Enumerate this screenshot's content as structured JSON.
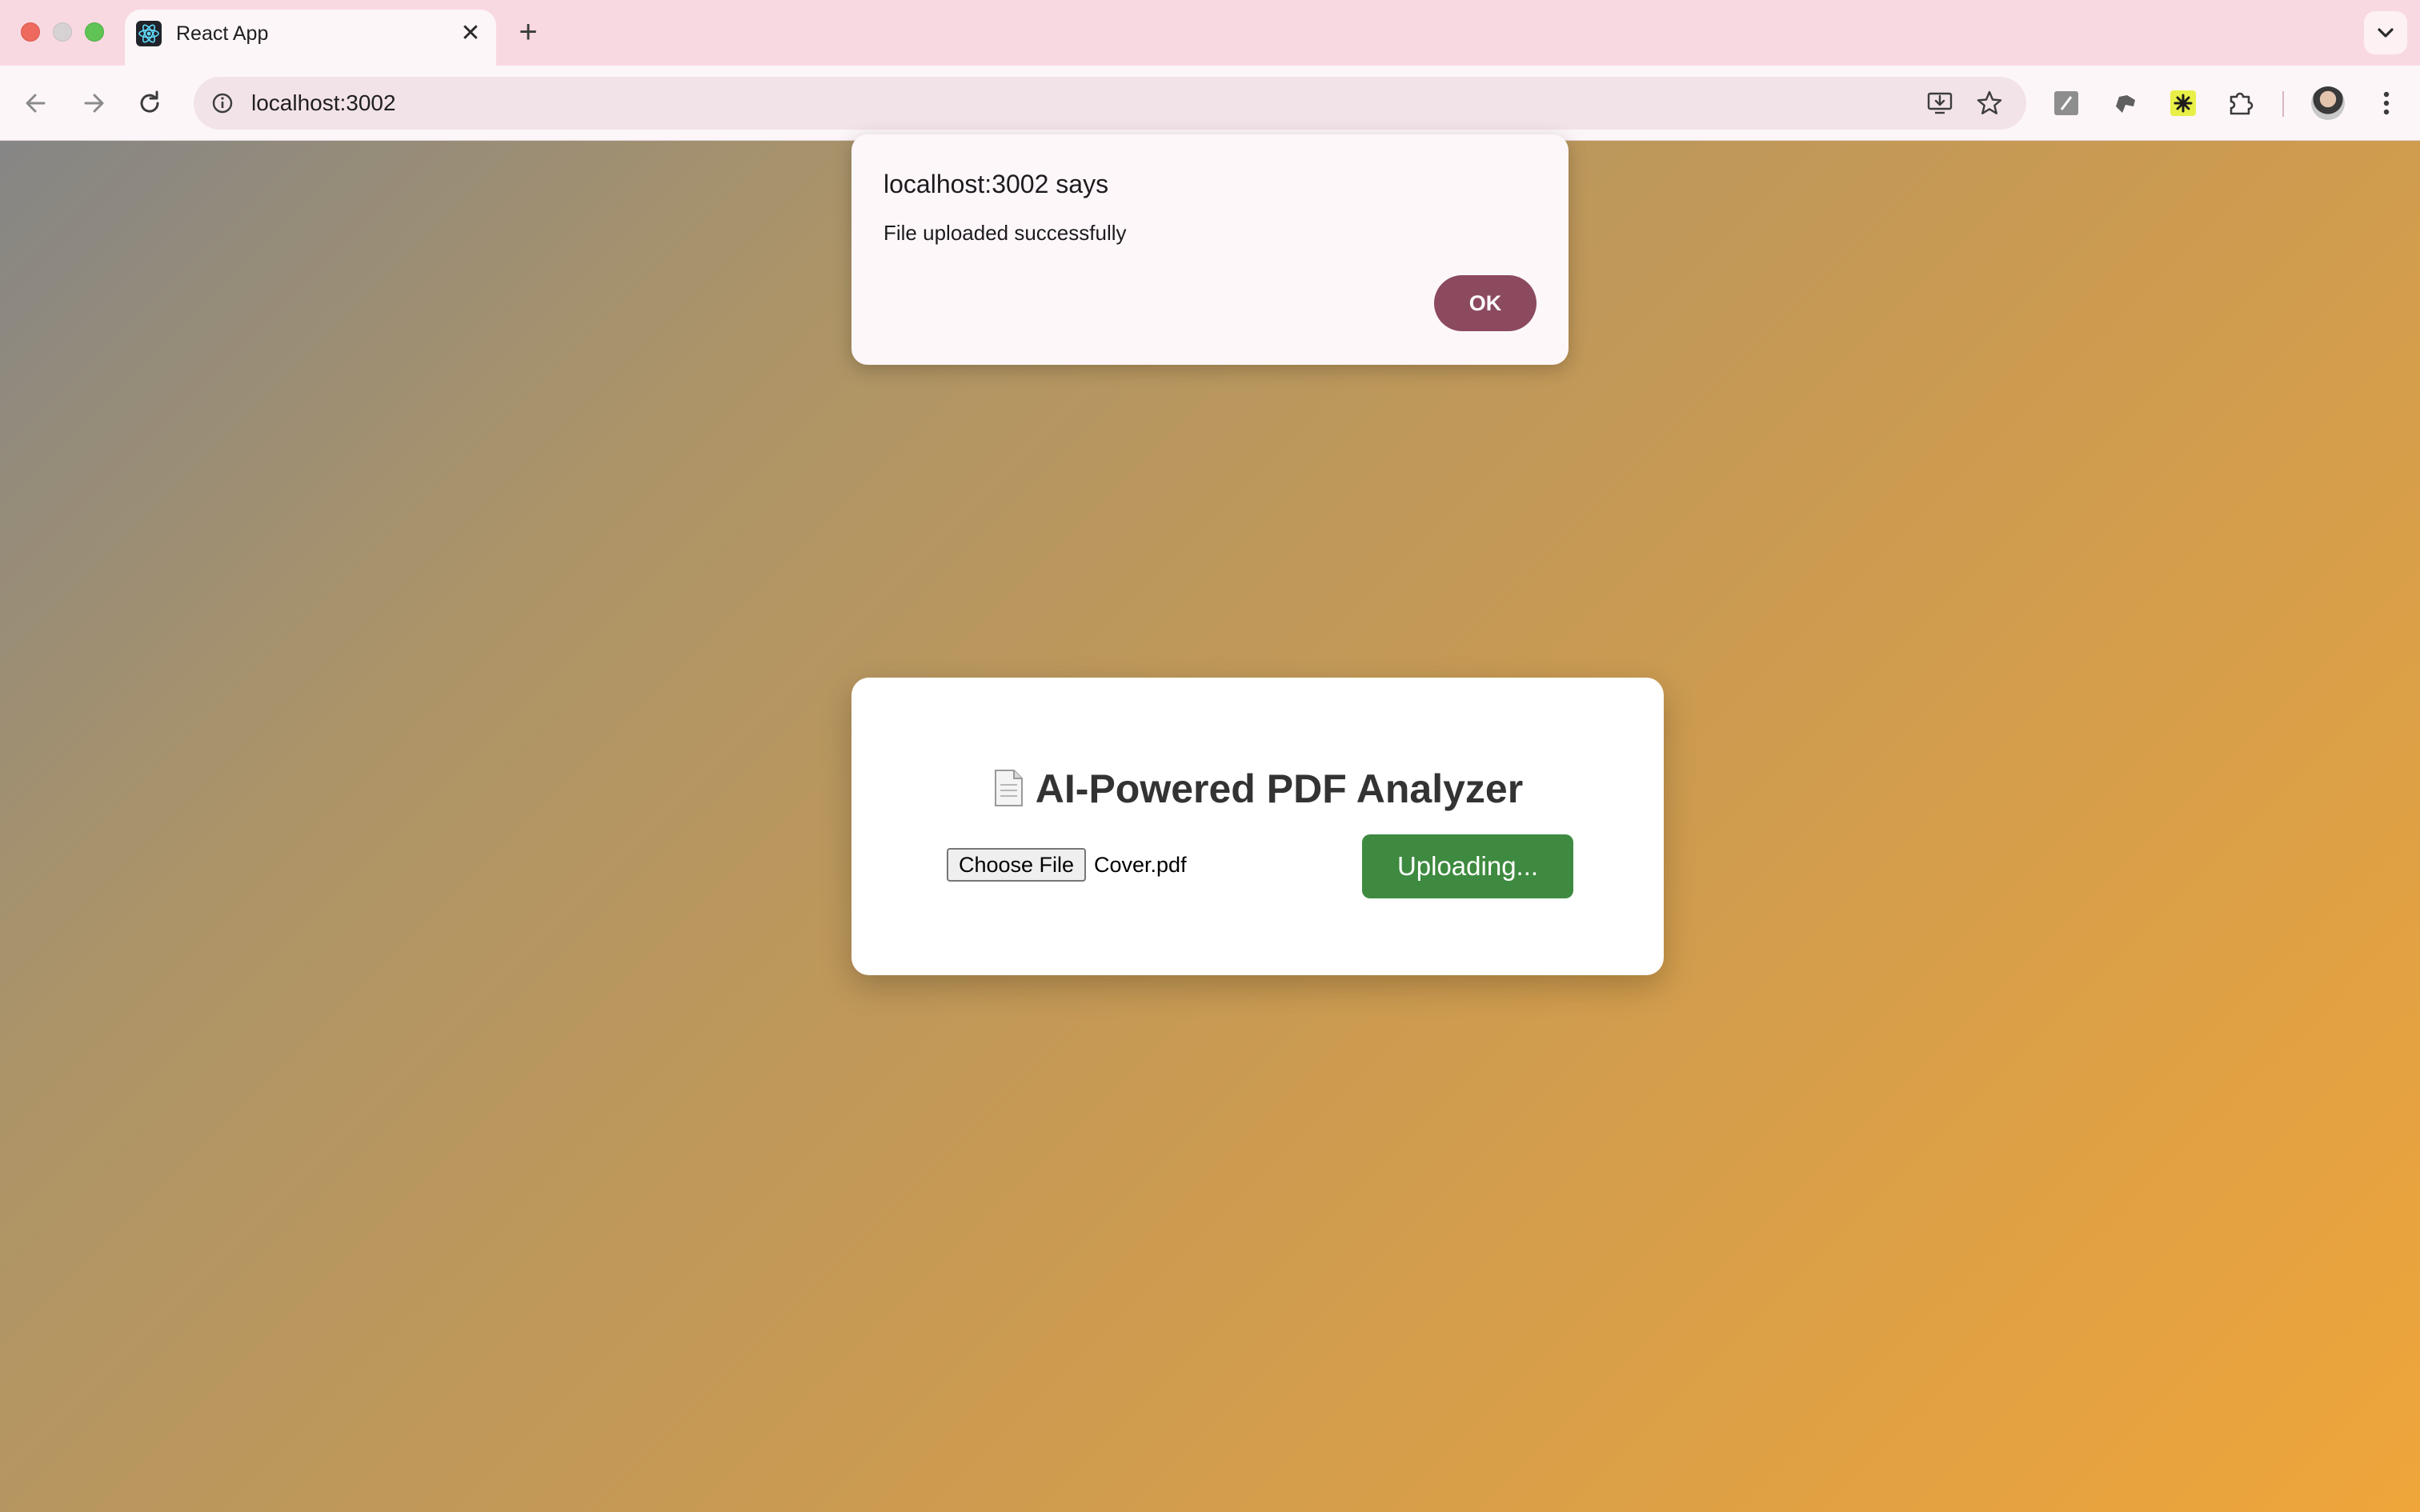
{
  "browser": {
    "tab_title": "React App",
    "tab_close_glyph": "✕",
    "new_tab_glyph": "+",
    "url": "localhost:3002",
    "icons": [
      "back-arrow-icon",
      "forward-arrow-icon",
      "reload-icon",
      "site-info-icon",
      "install-app-icon",
      "bookmark-star-icon",
      "extension-icon",
      "puzzle-icon",
      "profile-avatar",
      "kebab-menu-icon"
    ]
  },
  "app": {
    "title": "AI-Powered PDF Analyzer",
    "title_icon": "page-document-icon",
    "choose_file_label": "Choose File",
    "file_name": "Cover.pdf",
    "upload_button_label": "Uploading..."
  },
  "dialog": {
    "title": "localhost:3002 says",
    "message": "File uploaded successfully",
    "ok_label": "OK"
  },
  "colors": {
    "upload_button": "#3e8a40",
    "dialog_ok": "#8c4a5f",
    "chrome_background": "#f9d9e1",
    "gradient_start": "#868686",
    "gradient_end": "#efa53a"
  }
}
